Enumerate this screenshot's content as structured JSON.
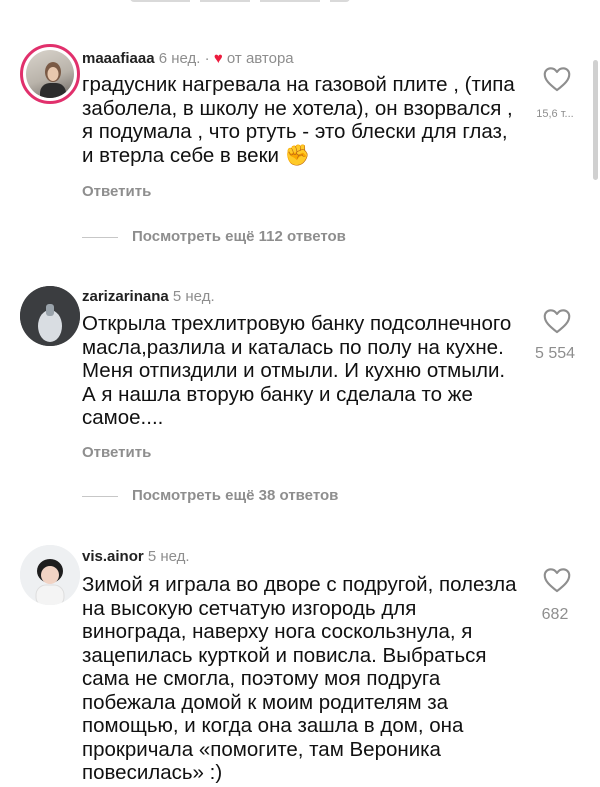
{
  "comments": [
    {
      "username": "maaafiaaa",
      "time": "6 нед.",
      "sep": "·",
      "author_label": "от автора",
      "text": "градусник нагревала на газовой плите , (типа заболела, в школу не хотела), он взорвался , я подумала , что ртуть - это блески для глаз, и втерла себе в веки ✊",
      "likes": "15,6 т...",
      "reply_label": "Ответить",
      "more_replies": "Посмотреть ещё 112 ответов"
    },
    {
      "username": "zarizarinana",
      "time": "5 нед.",
      "text": "Открыла трехлитровую банку подсолнечного масла,разлила и каталась по полу на кухне. Меня отпиздили и отмыли. И кухню отмыли. А я нашла вторую банку и сделала то же самое....",
      "likes": "5 554",
      "reply_label": "Ответить",
      "more_replies": "Посмотреть ещё 38 ответов"
    },
    {
      "username": "vis.ainor",
      "time": "5 нед.",
      "text": "Зимой я играла во дворе с подругой, полезла на высокую сетчатую изгородь для винограда, наверху нога соскользнула, я зацепилась курткой и повисла. Выбраться сама не смогла, поэтому моя подруга побежала домой к моим родителям за помощью, и когда она зашла в дом, она прокричала «помогите, там Вероника повесилась» :)",
      "likes": "682"
    }
  ],
  "icons": {
    "like": "heart-outline-icon",
    "author_heart": "heart-filled-icon"
  },
  "colors": {
    "muted": "#8e8e8e",
    "heart_red": "#ed1b3e",
    "story_ring": "#e1306c"
  }
}
